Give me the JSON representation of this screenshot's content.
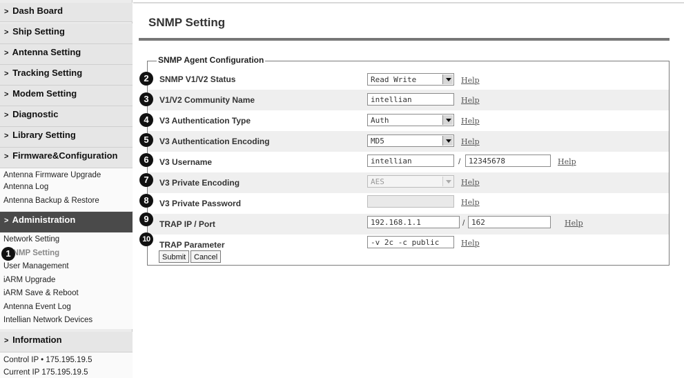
{
  "sidebar": {
    "main": [
      {
        "label": "Dash Board"
      },
      {
        "label": "Ship Setting"
      },
      {
        "label": "Antenna Setting"
      },
      {
        "label": "Tracking Setting"
      },
      {
        "label": "Modem Setting"
      },
      {
        "label": "Diagnostic"
      },
      {
        "label": "Library Setting"
      },
      {
        "label": "Firmware&Configuration"
      },
      {
        "label": "Administration"
      },
      {
        "label": "Information"
      }
    ],
    "chevron": ">",
    "firmware_items": [
      "Antenna Firmware Upgrade",
      "Antenna Log",
      "Antenna Backup & Restore"
    ],
    "admin_items": [
      "Network Setting",
      "SNMP Setting",
      "User Management",
      "iARM Upgrade",
      "iARM Save & Reboot",
      "Antenna Event Log",
      "Intellian Network Devices"
    ],
    "info": {
      "control_ip": "Control IP • 175.195.19.5",
      "current_ip": "Current IP  175.195.19.5"
    }
  },
  "page": {
    "title": "SNMP Setting",
    "legend": "SNMP Agent Configuration"
  },
  "form": {
    "rows": [
      {
        "label": "SNMP V1/V2 Status",
        "value": "Read Write",
        "help": "Help"
      },
      {
        "label": "V1/V2 Community Name",
        "value": "intellian",
        "help": "Help"
      },
      {
        "label": "V3 Authentication Type",
        "value": "Auth",
        "help": "Help"
      },
      {
        "label": "V3 Authentication Encoding",
        "value": "MD5",
        "help": "Help"
      },
      {
        "label": "V3 Username",
        "value": "intellian",
        "value2": "12345678",
        "separator": "/",
        "help": "Help"
      },
      {
        "label": "V3 Private Encoding",
        "value": "AES",
        "help": "Help"
      },
      {
        "label": "V3 Private Password",
        "value": "",
        "help": "Help"
      },
      {
        "label": "TRAP IP / Port",
        "value": "192.168.1.1",
        "value2": "162",
        "separator": "/",
        "help": "Help"
      },
      {
        "label": "TRAP Parameter",
        "value": "-v 2c -c public",
        "help": "Help"
      }
    ],
    "submit_label": "Submit",
    "cancel_label": "Cancel"
  },
  "callouts": [
    "1",
    "2",
    "3",
    "4",
    "5",
    "6",
    "7",
    "8",
    "9",
    "10"
  ]
}
